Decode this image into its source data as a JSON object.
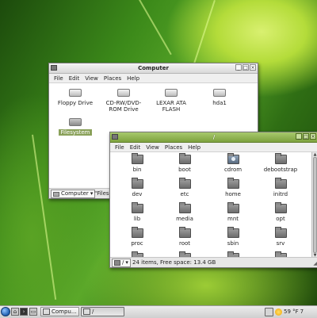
{
  "computer_window": {
    "title": "Computer",
    "menu": [
      "File",
      "Edit",
      "View",
      "Places",
      "Help"
    ],
    "drives": [
      {
        "label": "Floppy Drive",
        "icon": "floppy-icon"
      },
      {
        "label": "CD-RW/DVD-ROM Drive",
        "icon": "optical-drive-icon"
      },
      {
        "label": "LEXAR ATA FLASH",
        "icon": "flash-drive-icon"
      },
      {
        "label": "hda1",
        "icon": "hard-drive-icon"
      },
      {
        "label": "Filesystem",
        "icon": "filesystem-icon",
        "selected": true
      }
    ],
    "location_select": "Computer",
    "status": "\"Filesy"
  },
  "root_window": {
    "title": "/",
    "menu": [
      "File",
      "Edit",
      "View",
      "Places",
      "Help"
    ],
    "folders": [
      "bin",
      "boot",
      "cdrom",
      "debootstrap",
      "dev",
      "etc",
      "home",
      "initrd",
      "lib",
      "media",
      "mnt",
      "opt",
      "proc",
      "root",
      "sbin",
      "srv"
    ],
    "path_button": "/",
    "status": "24 items, Free space: 13.4 GB"
  },
  "taskbar": {
    "tasks": [
      {
        "label": "Compu..."
      },
      {
        "label": "/"
      }
    ],
    "weather": "59 °F",
    "clock_partial": "7"
  }
}
